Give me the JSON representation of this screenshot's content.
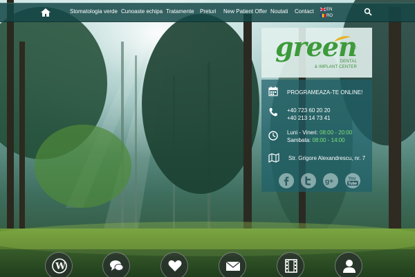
{
  "nav": {
    "items": [
      {
        "label": "Stomatologia verde"
      },
      {
        "label": "Cunoaste echipa"
      },
      {
        "label": "Tratamente"
      },
      {
        "label": "Preturi"
      },
      {
        "label": "New Patient Offer"
      },
      {
        "label": "Noutati"
      },
      {
        "label": "Contact"
      }
    ],
    "languages": [
      {
        "code": "EN"
      },
      {
        "code": "RO"
      }
    ],
    "icons": {
      "home": "home-icon",
      "search": "search-icon"
    }
  },
  "logo": {
    "word": "green",
    "registered": "®",
    "line1": "DENTAL",
    "line2": "& IMPLANT CENTER"
  },
  "info": {
    "booking": "PROGRAMEAZA-TE ONLINE!",
    "phone1": "+40 723 60 20 20",
    "phone2": "+40 213 14 73 41",
    "hours_weekday_label": "Luni - Vineri:",
    "hours_weekday_value": "08:00 - 20:00",
    "hours_saturday_label": "Sambata:",
    "hours_saturday_value": "08:00 - 14:00",
    "address": "Str. Grigore Alexandrescu, nr. 7"
  },
  "social": [
    "facebook-icon",
    "twitter-icon",
    "google-plus-icon",
    "youtube-icon"
  ],
  "bottom_icons": [
    "wordpress-icon",
    "chat-icon",
    "heart-icon",
    "mail-icon",
    "film-icon",
    "user-icon"
  ],
  "colors": {
    "brand_green": "#3d9a3a",
    "hours_green": "#7fe07a",
    "nav_bg": "#144646",
    "panel_bg": "#1e5f69"
  }
}
